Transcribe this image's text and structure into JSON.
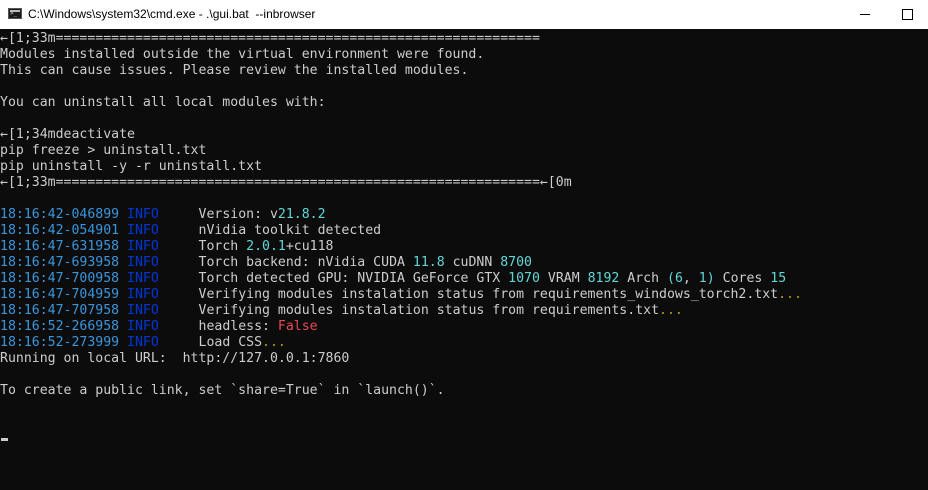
{
  "window": {
    "title": "C:\\Windows\\system32\\cmd.exe - .\\gui.bat  --inbrowser",
    "icons": {
      "app": "cmd-icon",
      "minimize": "minimize-icon",
      "maximize": "maximize-icon"
    }
  },
  "colors": {
    "background": "#0c0c0c",
    "foreground": "#cccccc",
    "timestamp": "#3a96dd",
    "info": "#0037da",
    "number": "#61d6d6",
    "ellipsis": "#c19c00",
    "false_value": "#e74856"
  },
  "console": {
    "warning_lines": [
      "←[1;33m=============================================================",
      "Modules installed outside the virtual environment were found.",
      "This can cause issues. Please review the installed modules.",
      "",
      "You can uninstall all local modules with:",
      "",
      "←[1;34mdeactivate",
      "pip freeze > uninstall.txt",
      "pip uninstall -y -r uninstall.txt",
      "←[1;33m=============================================================←[0m"
    ],
    "log": [
      {
        "time": "18:16:42-046899",
        "level": "INFO",
        "segments": [
          {
            "t": "Version: v"
          },
          {
            "t": "21.8.2",
            "c": "num"
          }
        ]
      },
      {
        "time": "18:16:42-054901",
        "level": "INFO",
        "segments": [
          {
            "t": "nVidia toolkit detected"
          }
        ]
      },
      {
        "time": "18:16:47-631958",
        "level": "INFO",
        "segments": [
          {
            "t": "Torch "
          },
          {
            "t": "2.0.1",
            "c": "num"
          },
          {
            "t": "+cu118"
          }
        ]
      },
      {
        "time": "18:16:47-693958",
        "level": "INFO",
        "segments": [
          {
            "t": "Torch backend: nVidia CUDA "
          },
          {
            "t": "11.8",
            "c": "num"
          },
          {
            "t": " cuDNN "
          },
          {
            "t": "8700",
            "c": "num"
          }
        ]
      },
      {
        "time": "18:16:47-700958",
        "level": "INFO",
        "segments": [
          {
            "t": "Torch detected GPU: NVIDIA GeForce GTX "
          },
          {
            "t": "1070",
            "c": "num"
          },
          {
            "t": " VRAM "
          },
          {
            "t": "8192",
            "c": "num"
          },
          {
            "t": " Arch "
          },
          {
            "t": "(",
            "c": "num"
          },
          {
            "t": "6",
            "c": "num"
          },
          {
            "t": ", "
          },
          {
            "t": "1",
            "c": "num"
          },
          {
            "t": ")",
            "c": "num"
          },
          {
            "t": " Cores "
          },
          {
            "t": "15",
            "c": "num"
          }
        ]
      },
      {
        "time": "18:16:47-704959",
        "level": "INFO",
        "segments": [
          {
            "t": "Verifying modules instalation status from requirements_windows_torch2.txt"
          },
          {
            "t": "...",
            "c": "warn"
          }
        ]
      },
      {
        "time": "18:16:47-707958",
        "level": "INFO",
        "segments": [
          {
            "t": "Verifying modules instalation status from requirements.txt"
          },
          {
            "t": "...",
            "c": "warn"
          }
        ]
      },
      {
        "time": "18:16:52-266958",
        "level": "INFO",
        "segments": [
          {
            "t": "headless: "
          },
          {
            "t": "False",
            "c": "err"
          }
        ]
      },
      {
        "time": "18:16:52-273999",
        "level": "INFO",
        "segments": [
          {
            "t": "Load CSS"
          },
          {
            "t": "...",
            "c": "warn"
          }
        ]
      }
    ],
    "local_url_line": "Running on local URL:  http://127.0.0.1:7860",
    "public_link_line": "To create a public link, set `share=True` in `launch()`."
  }
}
